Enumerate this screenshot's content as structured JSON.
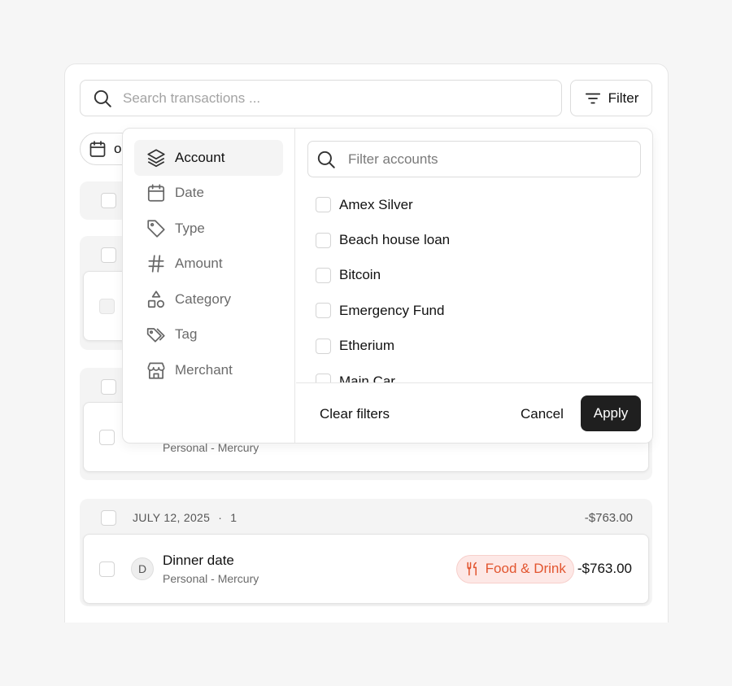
{
  "search": {
    "placeholder": "Search transactions ..."
  },
  "filter_button": {
    "label": "Filter"
  },
  "date_chip": {
    "label": "o"
  },
  "groups": [
    {
      "date": "",
      "total": "",
      "rows": []
    },
    {
      "date": "",
      "total": "",
      "rows": [
        {
          "avatar": "",
          "title": "",
          "subtitle": "",
          "category": "",
          "amount": ""
        }
      ]
    },
    {
      "date": "",
      "total": "",
      "rows": [
        {
          "avatar": "",
          "title": "",
          "subtitle": "Personal - Mercury",
          "category": "",
          "amount": ""
        }
      ]
    },
    {
      "date": "JULY 12, 2025",
      "dot": "·",
      "count": "1",
      "total": "-$763.00",
      "rows": [
        {
          "avatar": "D",
          "title": "Dinner date",
          "subtitle": "Personal - Mercury",
          "category": "Food & Drink",
          "category_icon": "fork-knife-icon",
          "amount": "-$763.00"
        }
      ]
    }
  ],
  "popover": {
    "menu": [
      {
        "label": "Account",
        "icon": "layers-icon",
        "active": true
      },
      {
        "label": "Date",
        "icon": "calendar-icon"
      },
      {
        "label": "Type",
        "icon": "tag-icon"
      },
      {
        "label": "Amount",
        "icon": "hash-icon"
      },
      {
        "label": "Category",
        "icon": "shapes-icon"
      },
      {
        "label": "Tag",
        "icon": "tags-icon"
      },
      {
        "label": "Merchant",
        "icon": "store-icon"
      }
    ],
    "account_search": {
      "placeholder": "Filter accounts"
    },
    "accounts": [
      "Amex Silver",
      "Beach house loan",
      "Bitcoin",
      "Emergency Fund",
      "Etherium",
      "Main Car"
    ],
    "footer": {
      "clear": "Clear filters",
      "cancel": "Cancel",
      "apply": "Apply"
    }
  },
  "colors": {
    "accent": "#e2552f",
    "pill_bg": "#fde8e6",
    "apply_bg": "#1f1f1f"
  }
}
